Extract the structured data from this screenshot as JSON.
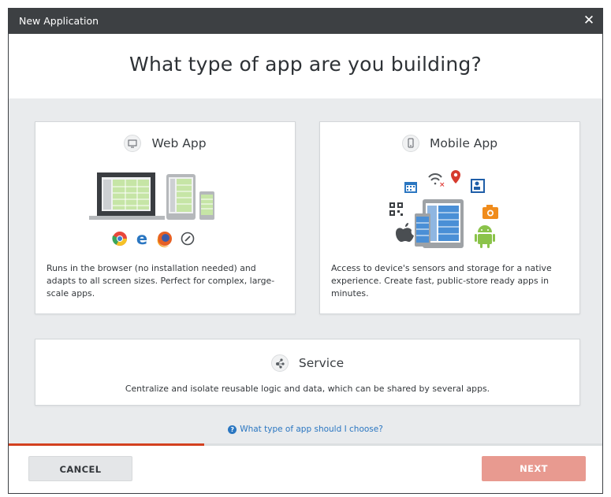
{
  "dialog": {
    "title": "New Application",
    "close_glyph": "✕"
  },
  "header": {
    "question": "What type of app are you building?"
  },
  "cards": {
    "web": {
      "label": "Web App",
      "icon": "monitor-icon",
      "description": "Runs in the browser (no installation needed) and adapts to all screen sizes. Perfect for complex, large-scale apps.",
      "browsers": [
        "chrome-icon",
        "edge-icon",
        "firefox-icon",
        "safari-icon"
      ]
    },
    "mobile": {
      "label": "Mobile App",
      "icon": "phone-icon",
      "description": "Access to device's sensors and storage for a native experience. Create fast, public-store ready apps in minutes.",
      "features": [
        "calendar-icon",
        "wifi-icon",
        "location-pin-icon",
        "contacts-icon",
        "qr-code-icon",
        "camera-icon",
        "apple-icon",
        "android-icon"
      ]
    },
    "service": {
      "label": "Service",
      "icon": "service-nodes-icon",
      "description": "Centralize and isolate reusable logic and data, which can be shared by several apps."
    }
  },
  "help": {
    "link_text": "What type of app should I choose?",
    "icon_glyph": "?"
  },
  "footer": {
    "cancel_label": "CANCEL",
    "next_label": "NEXT",
    "progress_fraction": 0.33
  },
  "colors": {
    "titlebar": "#3d4043",
    "accent": "#d3401f",
    "next_button": "#e89a90",
    "link": "#2a76c1",
    "background": "#e9ebed"
  }
}
